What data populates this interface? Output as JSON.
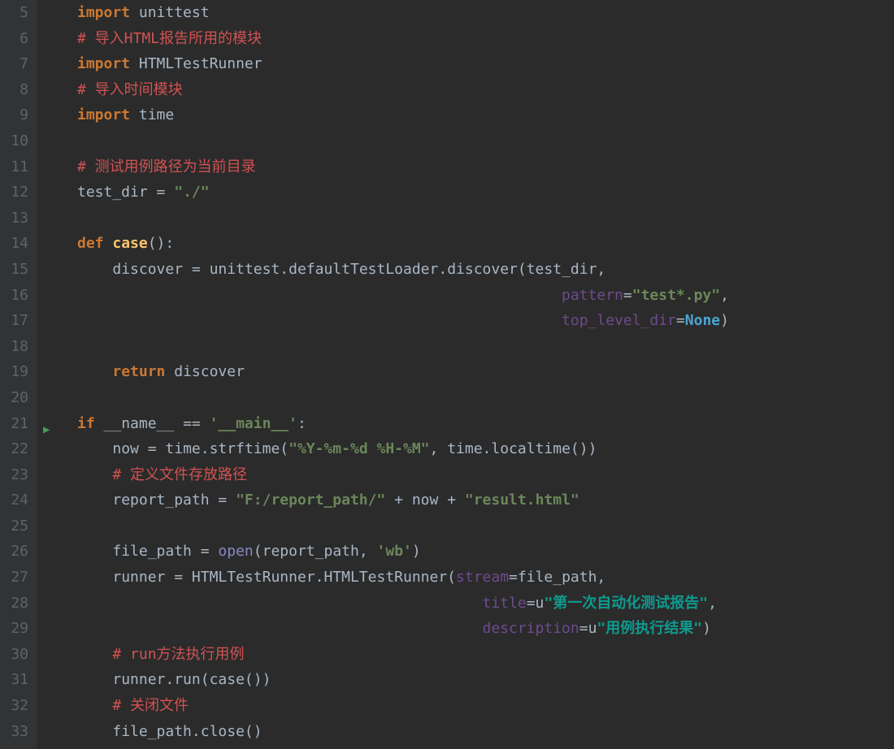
{
  "gutter": {
    "start": 5,
    "end": 33
  },
  "run_marker_line": 21,
  "lines": {
    "l5": [
      [
        "kw",
        "import"
      ],
      [
        "op",
        " "
      ],
      [
        "ident",
        "unittest"
      ]
    ],
    "l6": [
      [
        "cmt",
        "# 导入HTML报告所用的模块"
      ]
    ],
    "l7": [
      [
        "kw",
        "import"
      ],
      [
        "op",
        " "
      ],
      [
        "ident",
        "HTMLTestRunner"
      ]
    ],
    "l8": [
      [
        "cmt",
        "# 导入时间模块"
      ]
    ],
    "l9": [
      [
        "kw",
        "import"
      ],
      [
        "op",
        " "
      ],
      [
        "ident",
        "time"
      ]
    ],
    "l10": [],
    "l11": [
      [
        "cmt",
        "# 测试用例路径为当前目录"
      ]
    ],
    "l12": [
      [
        "ident",
        "test_dir "
      ],
      [
        "op",
        "= "
      ],
      [
        "str",
        "\"./\""
      ]
    ],
    "l13": [],
    "l14": [
      [
        "kw",
        "def "
      ],
      [
        "func",
        "case"
      ],
      [
        "op",
        "():"
      ]
    ],
    "l15": [
      [
        "op",
        "    "
      ],
      [
        "ident",
        "discover "
      ],
      [
        "op",
        "= "
      ],
      [
        "ident",
        "unittest.defaultTestLoader.discover(test_dir,"
      ]
    ],
    "l16": [
      [
        "op",
        "                                                       "
      ],
      [
        "param",
        "pattern"
      ],
      [
        "op",
        "="
      ],
      [
        "str",
        "\"test*.py\""
      ],
      [
        "op",
        ","
      ]
    ],
    "l17": [
      [
        "op",
        "                                                       "
      ],
      [
        "param",
        "top_level_dir"
      ],
      [
        "op",
        "="
      ],
      [
        "none",
        "None"
      ],
      [
        "op",
        ")"
      ]
    ],
    "l18": [],
    "l19": [
      [
        "op",
        "    "
      ],
      [
        "kw",
        "return "
      ],
      [
        "ident",
        "discover"
      ]
    ],
    "l20": [],
    "l21": [
      [
        "kw",
        "if "
      ],
      [
        "ident",
        "__name__ "
      ],
      [
        "op",
        "== "
      ],
      [
        "str",
        "'__main__'"
      ],
      [
        "op",
        ":"
      ]
    ],
    "l22": [
      [
        "op",
        "    "
      ],
      [
        "ident",
        "now "
      ],
      [
        "op",
        "= "
      ],
      [
        "ident",
        "time.strftime("
      ],
      [
        "str",
        "\"%Y-%m-%d %H-%M\""
      ],
      [
        "op",
        ", "
      ],
      [
        "ident",
        "time.localtime())"
      ]
    ],
    "l23": [
      [
        "op",
        "    "
      ],
      [
        "cmt",
        "# 定义文件存放路径"
      ]
    ],
    "l24": [
      [
        "op",
        "    "
      ],
      [
        "ident",
        "report_path "
      ],
      [
        "op",
        "= "
      ],
      [
        "str",
        "\"F:/report_path/\""
      ],
      [
        "op",
        " + "
      ],
      [
        "ident",
        "now"
      ],
      [
        "op",
        " + "
      ],
      [
        "str",
        "\"result.html\""
      ]
    ],
    "l25": [],
    "l26": [
      [
        "op",
        "    "
      ],
      [
        "ident",
        "file_path "
      ],
      [
        "op",
        "= "
      ],
      [
        "builtin",
        "open"
      ],
      [
        "op",
        "("
      ],
      [
        "ident",
        "report_path"
      ],
      [
        "op",
        ", "
      ],
      [
        "str",
        "'wb'"
      ],
      [
        "op",
        ")"
      ]
    ],
    "l27": [
      [
        "op",
        "    "
      ],
      [
        "ident",
        "runner "
      ],
      [
        "op",
        "= "
      ],
      [
        "ident",
        "HTMLTestRunner.HTMLTestRunner("
      ],
      [
        "param",
        "stream"
      ],
      [
        "op",
        "="
      ],
      [
        "ident",
        "file_path,"
      ]
    ],
    "l28": [
      [
        "op",
        "                                              "
      ],
      [
        "param",
        "title"
      ],
      [
        "op",
        "="
      ],
      [
        "uprefix",
        "u"
      ],
      [
        "strcn",
        "\"第一次自动化测试报告\""
      ],
      [
        "op",
        ","
      ]
    ],
    "l29": [
      [
        "op",
        "                                              "
      ],
      [
        "param",
        "description"
      ],
      [
        "op",
        "="
      ],
      [
        "uprefix",
        "u"
      ],
      [
        "strcn",
        "\"用例执行结果\""
      ],
      [
        "op",
        ")"
      ]
    ],
    "l30": [
      [
        "op",
        "    "
      ],
      [
        "cmt",
        "# run方法执行用例"
      ]
    ],
    "l31": [
      [
        "op",
        "    "
      ],
      [
        "ident",
        "runner.run(case())"
      ]
    ],
    "l32": [
      [
        "op",
        "    "
      ],
      [
        "cmt",
        "# 关闭文件"
      ]
    ],
    "l33": [
      [
        "op",
        "    "
      ],
      [
        "ident",
        "file_path.close()"
      ]
    ]
  }
}
